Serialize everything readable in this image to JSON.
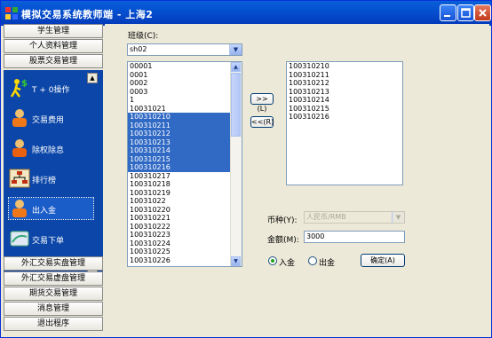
{
  "window": {
    "title": "模拟交易系统教师端 - 上海2",
    "buttons": {
      "minimize": "minimize-icon",
      "maximize": "maximize-icon",
      "close": "close-icon"
    }
  },
  "sidebar": {
    "top_headers": [
      "学生管理",
      "个人资料管理",
      "股票交易管理"
    ],
    "items": [
      {
        "label": "T + 0操作",
        "icon": "t0-trade-icon"
      },
      {
        "label": "交易费用",
        "icon": "fee-icon"
      },
      {
        "label": "除权除息",
        "icon": "dividend-icon"
      },
      {
        "label": "排行榜",
        "icon": "ranking-icon"
      },
      {
        "label": "出入金",
        "icon": "funds-icon"
      },
      {
        "label": "交易下单",
        "icon": "order-icon"
      }
    ],
    "bottom_headers": [
      "外汇交易实盘管理",
      "外汇交易虚盘管理",
      "期货交易管理",
      "消息管理",
      "退出程序"
    ]
  },
  "main": {
    "class_label": "班级(C):",
    "class_value": "sh02",
    "left_list": [
      "00001",
      "0001",
      "0002",
      "0003",
      "1",
      "10031021",
      "100310210",
      "100310211",
      "100310212",
      "100310213",
      "100310214",
      "100310215",
      "100310216",
      "100310217",
      "100310218",
      "100310219",
      "10031022",
      "100310220",
      "100310221",
      "100310222",
      "100310223",
      "100310224",
      "100310225",
      "100310226"
    ],
    "selected": [
      "100310210",
      "100310211",
      "100310212",
      "100310213",
      "100310214",
      "100310215",
      "100310216"
    ],
    "right_list": [
      "100310210",
      "100310211",
      "100310212",
      "100310213",
      "100310214",
      "100310215",
      "100310216"
    ],
    "add_button": ">>(L)",
    "remove_button": "<<(R)",
    "currency_label": "币种(Y):",
    "currency_value": "人民币/RMB",
    "amount_label": "金额(M):",
    "amount_value": "3000",
    "radio_deposit": "入金",
    "radio_withdraw": "出金",
    "confirm_button": "确定(A)"
  },
  "colors": {
    "titlebar": "#0450d0",
    "nav_panel": "#0b46a8",
    "selection": "#316ac5"
  }
}
